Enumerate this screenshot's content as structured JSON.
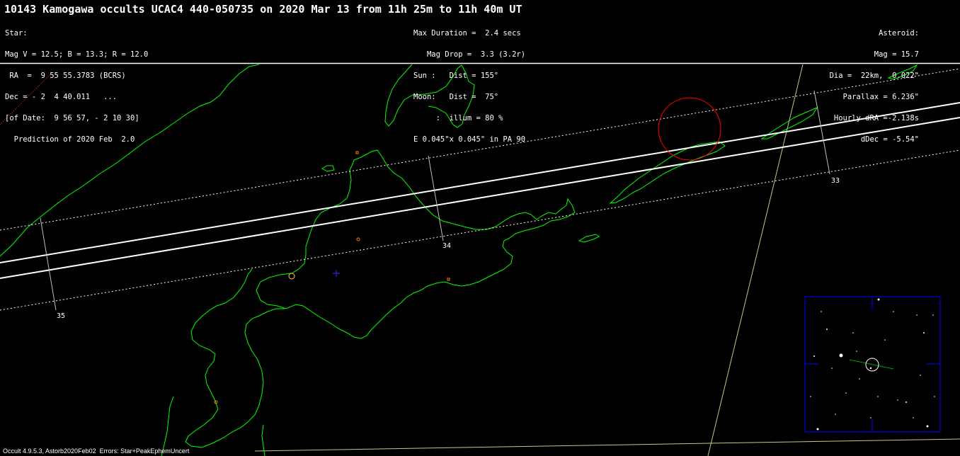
{
  "title": "10143 Kamogawa occults UCAC4 440-050735 on 2020 Mar 13 from 11h 25m to 11h 40m UT",
  "star_info": [
    "Star:",
    "Mag V = 12.5; B = 13.3; R = 12.0",
    " RA  =  9 55 55.3783 (BCRS)",
    "Dec = - 2  4 40.011   ...",
    "[of Date:  9 56 57, - 2 10 30]",
    "  Prediction of 2020 Feb  2.0"
  ],
  "event_info": [
    "Max Duration =  2.4 secs",
    "   Mag Drop =  3.3 (3.2r)",
    "Sun :   Dist = 155°",
    "Moon:   Dist =  75°",
    "     :  illum = 80 %",
    "E 0.045\"x 0.045\" in PA 90"
  ],
  "asteroid_info": [
    "Asteroid:",
    "Mag = 15.7",
    "Dia =  22km,  0.022\"",
    "Parallax = 6.236\"",
    "Hourly dRA =-2.138s",
    "dDec = -5.54\""
  ],
  "tick_labels": {
    "t33": "33",
    "t34": "34",
    "t35": "35"
  },
  "footer": "Occult 4.9.5.3, Astorb2020Feb02  Errors: Star+PeakEphemUncert",
  "colors": {
    "background": "#000000",
    "coastline": "#00ff00",
    "path": "#ffffff",
    "moon_circle": "#ff0000",
    "inset_frame": "#0000ff",
    "grid_line": "#c8c880",
    "site_marker": "#ff8000",
    "center_cross": "#3030ff"
  }
}
